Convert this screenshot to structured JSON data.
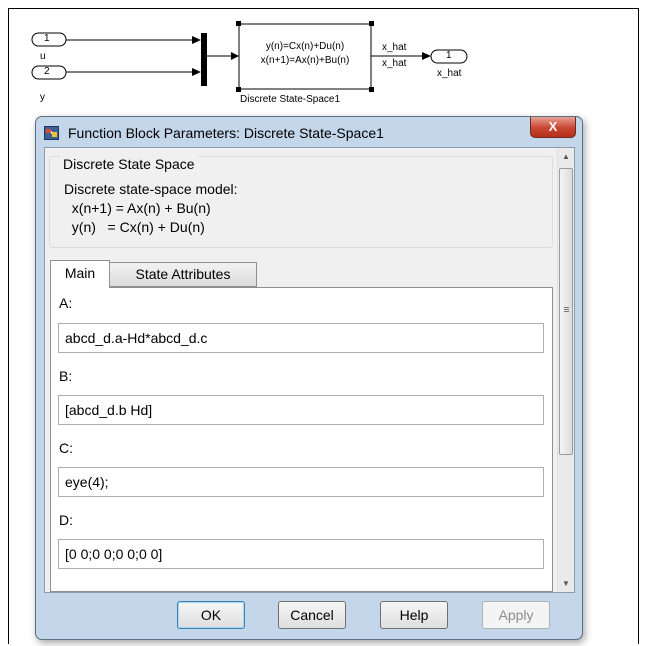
{
  "diagram": {
    "inport1": {
      "number": "1",
      "label": "u"
    },
    "inport2": {
      "number": "2",
      "label": "y"
    },
    "block": {
      "line1": "y(n)=Cx(n)+Du(n)",
      "line2": "x(n+1)=Ax(n)+Bu(n)",
      "name": "Discrete State-Space1",
      "out_label1": "x_hat",
      "out_label2": "x_hat"
    },
    "outport": {
      "number": "1",
      "label": "x_hat"
    }
  },
  "dialog": {
    "title": "Function Block Parameters: Discrete State-Space1",
    "close_glyph": "X",
    "group_title": "Discrete State Space",
    "description": [
      "Discrete state-space model:",
      "  x(n+1) = Ax(n) + Bu(n)",
      "  y(n)   = Cx(n) + Du(n)"
    ],
    "tabs": [
      {
        "label": "Main",
        "active": true
      },
      {
        "label": "State Attributes",
        "active": false
      }
    ],
    "fields": [
      {
        "label": "A:",
        "value": "abcd_d.a-Hd*abcd_d.c"
      },
      {
        "label": "B:",
        "value": "[abcd_d.b Hd]"
      },
      {
        "label": "C:",
        "value": "eye(4);"
      },
      {
        "label": "D:",
        "value": "[0 0;0 0;0 0;0 0]"
      }
    ],
    "buttons": {
      "ok": "OK",
      "cancel": "Cancel",
      "help": "Help",
      "apply": "Apply"
    },
    "icons": {
      "title": "simulink-block-icon",
      "scroll_up": "chevron-up-icon",
      "scroll_down": "chevron-down-icon"
    }
  }
}
